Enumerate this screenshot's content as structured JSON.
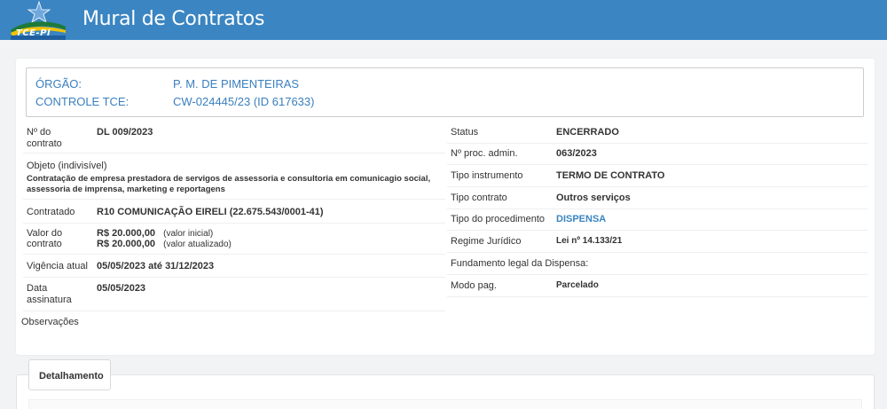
{
  "header": {
    "logo_text": "TCE-PI",
    "title": "Mural de Contratos"
  },
  "orgao": {
    "orgao_label": "ÓRGÃO:",
    "orgao_value": "P. M. DE PIMENTEIRAS",
    "controle_label": "CONTROLE TCE:",
    "controle_value": "CW-024445/23 (ID 617633)"
  },
  "left": {
    "numero_label_1": "Nº do",
    "numero_label_2": "contrato",
    "numero_value": "DL 009/2023",
    "objeto_label": "Objeto (indivisível)",
    "objeto_value_1": "Contratação de empresa prestadora de servigos de assessoria e consultoria em comunicagio social,",
    "objeto_value_2": "assessoria de imprensa, marketing e reportagens",
    "contratado_label": "Contratado",
    "contratado_value": "R10 COMUNICAÇÃO EIRELI (22.675.543/0001-41)",
    "valor_label_1": "Valor do",
    "valor_label_2": "contrato",
    "valor_inicial": "R$ 20.000,00",
    "valor_inicial_note": "(valor inicial)",
    "valor_atualizado": "R$ 20.000,00",
    "valor_atualizado_note": "(valor atualizado)",
    "vigencia_label": "Vigência atual",
    "vigencia_value": "05/05/2023 até 31/12/2023",
    "data_label_1": "Data",
    "data_label_2": "assinatura",
    "data_value": "05/05/2023",
    "observacoes_label": "Observações"
  },
  "right": {
    "status_label": "Status",
    "status_value": "ENCERRADO",
    "proc_label": "Nº proc. admin.",
    "proc_value": "063/2023",
    "tipo_instrumento_label": "Tipo instrumento",
    "tipo_instrumento_value": "TERMO DE CONTRATO",
    "tipo_contrato_label": "Tipo contrato",
    "tipo_contrato_value": "Outros serviços",
    "tipo_procedimento_label": "Tipo do procedimento",
    "tipo_procedimento_value": "DISPENSA",
    "regime_label": "Regime Jurídico",
    "regime_value": "Lei nº 14.133/21",
    "fundamento_label": "Fundamento legal da Dispensa:",
    "modo_pag_label": "Modo pag.",
    "modo_pag_value": "Parcelado"
  },
  "detalhamento": {
    "tab_label": "Detalhamento"
  },
  "colors": {
    "header_bg": "#3a85c2",
    "link": "#3a85c2",
    "page_bg": "#f1f3f4"
  }
}
